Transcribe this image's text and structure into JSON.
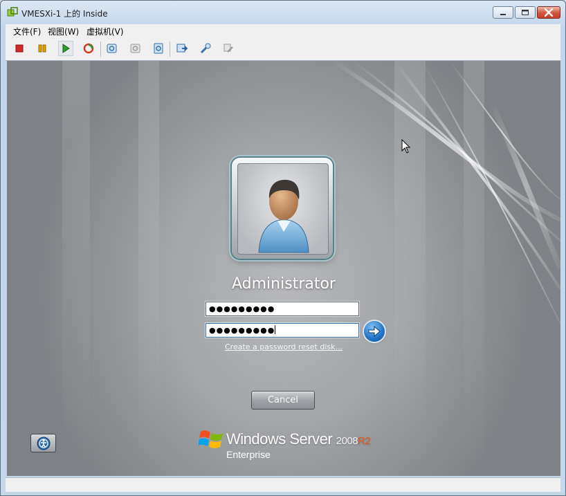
{
  "window": {
    "title": "VMESXi-1 上的 Inside",
    "controls": {
      "minimize": "minimize",
      "maximize": "maximize",
      "close": "close"
    }
  },
  "menubar": {
    "items": [
      {
        "label": "文件(F)"
      },
      {
        "label": "视图(W)"
      },
      {
        "label": "虚拟机(V)"
      }
    ]
  },
  "toolbar": {
    "buttons": [
      {
        "icon": "stop-icon",
        "color": "#d42a2a"
      },
      {
        "icon": "pause-icon",
        "color": "#e0a100"
      },
      {
        "icon": "play-icon",
        "color": "#2a9d2a"
      },
      {
        "icon": "reset-icon",
        "color": "#d43a2a"
      },
      {
        "icon": "snapshot-take-icon"
      },
      {
        "icon": "snapshot-revert-icon",
        "disabled": true
      },
      {
        "icon": "snapshot-manager-icon"
      },
      {
        "icon": "console-settings-icon"
      },
      {
        "icon": "edit-settings-icon"
      },
      {
        "icon": "vm-tools-icon",
        "disabled": true
      }
    ]
  },
  "login": {
    "username": "Administrator",
    "password_field_1": "●●●●●●●●●",
    "password_field_2": "●●●●●●●●●",
    "reset_link": "Create a password reset disk...",
    "cancel_label": "Cancel"
  },
  "branding": {
    "name": "Windows Server",
    "year": "2008",
    "release": "R2",
    "edition": "Enterprise",
    "accent_color": "#e35a1d"
  },
  "colors": {
    "title_bar": "#c3d5ea",
    "close_button": "#c4402a",
    "login_background": "#a4a6a9"
  }
}
